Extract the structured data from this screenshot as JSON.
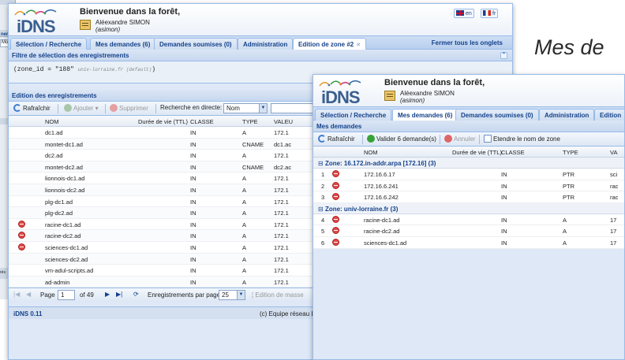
{
  "back_window": {
    "title_fragment": "ner",
    "field_fragment": "Mo",
    "footer_fragment": "rés"
  },
  "overlay_caption": "Mes de",
  "window1": {
    "logo": "iDNS",
    "welcome": "Bienvenue dans la forêt,",
    "user_name": "Aléexandre SIMON",
    "user_login": "(asimon)",
    "lang_en": "en",
    "lang_fr": "fr",
    "tabs": [
      {
        "label": "Sélection / Recherche"
      },
      {
        "label": "Mes demandes (6)"
      },
      {
        "label": "Demandes soumises (0)"
      },
      {
        "label": "Administration"
      },
      {
        "label": "Edition de zone #2"
      }
    ],
    "close_all": "Fermer tous les onglets",
    "filter_title": "Filtre de sélection des enregistrements",
    "filter_expr": "(zone_id = \"188\"",
    "filter_default": "univ-lorraine.fr (default)",
    "filter_close": ")",
    "edit_title": "Edition des enregistrements",
    "toolbar": {
      "refresh": "Rafraîchir",
      "add": "Ajouter",
      "delete": "Supprimer",
      "search_label": "Recherche en directe:",
      "search_field": "Nom"
    },
    "columns": [
      "NOM",
      "Durée de vie (TTL)",
      "CLASSE",
      "TYPE",
      "VALEU"
    ],
    "rows": [
      {
        "name": "dc1.ad",
        "ttl": "",
        "class": "IN",
        "type": "A",
        "value": "172.1",
        "marked": false
      },
      {
        "name": "montet-dc1.ad",
        "ttl": "",
        "class": "IN",
        "type": "CNAME",
        "value": "dc1.ac",
        "marked": false
      },
      {
        "name": "dc2.ad",
        "ttl": "",
        "class": "IN",
        "type": "A",
        "value": "172.1",
        "marked": false
      },
      {
        "name": "montet-dc2.ad",
        "ttl": "",
        "class": "IN",
        "type": "CNAME",
        "value": "dc2.ac",
        "marked": false
      },
      {
        "name": "lionnois-dc1.ad",
        "ttl": "",
        "class": "IN",
        "type": "A",
        "value": "172.1",
        "marked": false
      },
      {
        "name": "lionnois-dc2.ad",
        "ttl": "",
        "class": "IN",
        "type": "A",
        "value": "172.1",
        "marked": false
      },
      {
        "name": "plg-dc1.ad",
        "ttl": "",
        "class": "IN",
        "type": "A",
        "value": "172.1",
        "marked": false
      },
      {
        "name": "plg-dc2.ad",
        "ttl": "",
        "class": "IN",
        "type": "A",
        "value": "172.1",
        "marked": false
      },
      {
        "name": "racine-dc1.ad",
        "ttl": "",
        "class": "IN",
        "type": "A",
        "value": "172.1",
        "marked": true
      },
      {
        "name": "racine-dc2.ad",
        "ttl": "",
        "class": "IN",
        "type": "A",
        "value": "172.1",
        "marked": true
      },
      {
        "name": "sciences-dc1.ad",
        "ttl": "",
        "class": "IN",
        "type": "A",
        "value": "172.1",
        "marked": true
      },
      {
        "name": "sciences-dc2.ad",
        "ttl": "",
        "class": "IN",
        "type": "A",
        "value": "172.1",
        "marked": false
      },
      {
        "name": "vm-adul-scripts.ad",
        "ttl": "",
        "class": "IN",
        "type": "A",
        "value": "172.1",
        "marked": false
      },
      {
        "name": "ad-admin",
        "ttl": "",
        "class": "IN",
        "type": "A",
        "value": "172.1",
        "marked": false
      }
    ],
    "pager": {
      "page_label": "Page",
      "page_value": "1",
      "of_label": "of 49",
      "per_page_label": "Enregistrements par page",
      "per_page_value": "25",
      "bulk_edit": "Edition de masse"
    },
    "status_left": "iDNS 0.11",
    "status_right": "(c) Equipe réseau L"
  },
  "window2": {
    "logo": "iDNS",
    "welcome": "Bienvenue dans la forêt,",
    "user_name": "Aléexandre SIMON",
    "user_login": "(asimon)",
    "tabs": [
      {
        "label": "Sélection / Recherche"
      },
      {
        "label": "Mes demandes (6)"
      },
      {
        "label": "Demandes soumises (0)"
      },
      {
        "label": "Administration"
      },
      {
        "label": "Edition"
      }
    ],
    "panel_title": "Mes demandes",
    "toolbar": {
      "refresh": "Rafraîchir",
      "validate": "Valider 6 demande(s)",
      "cancel": "Annuler",
      "expand": "Etendre le nom de zone"
    },
    "columns": [
      "NOM",
      "Durée de vie (TTL)",
      "CLASSE",
      "TYPE",
      "VA"
    ],
    "groups": [
      {
        "label": "Zone: 16.172.in-addr.arpa [172.16] (3)",
        "rows": [
          {
            "num": "1",
            "name": "172.16.6.17",
            "class": "IN",
            "type": "PTR",
            "value": "sci"
          },
          {
            "num": "2",
            "name": "172.16.6.241",
            "class": "IN",
            "type": "PTR",
            "value": "rac"
          },
          {
            "num": "3",
            "name": "172.16.6.242",
            "class": "IN",
            "type": "PTR",
            "value": "rac"
          }
        ]
      },
      {
        "label": "Zone: univ-lorraine.fr (3)",
        "rows": [
          {
            "num": "4",
            "name": "racine-dc1.ad",
            "class": "IN",
            "type": "A",
            "value": "17"
          },
          {
            "num": "5",
            "name": "racine-dc2.ad",
            "class": "IN",
            "type": "A",
            "value": "17"
          },
          {
            "num": "6",
            "name": "sciences-dc1.ad",
            "class": "IN",
            "type": "A",
            "value": "17"
          }
        ]
      }
    ]
  }
}
